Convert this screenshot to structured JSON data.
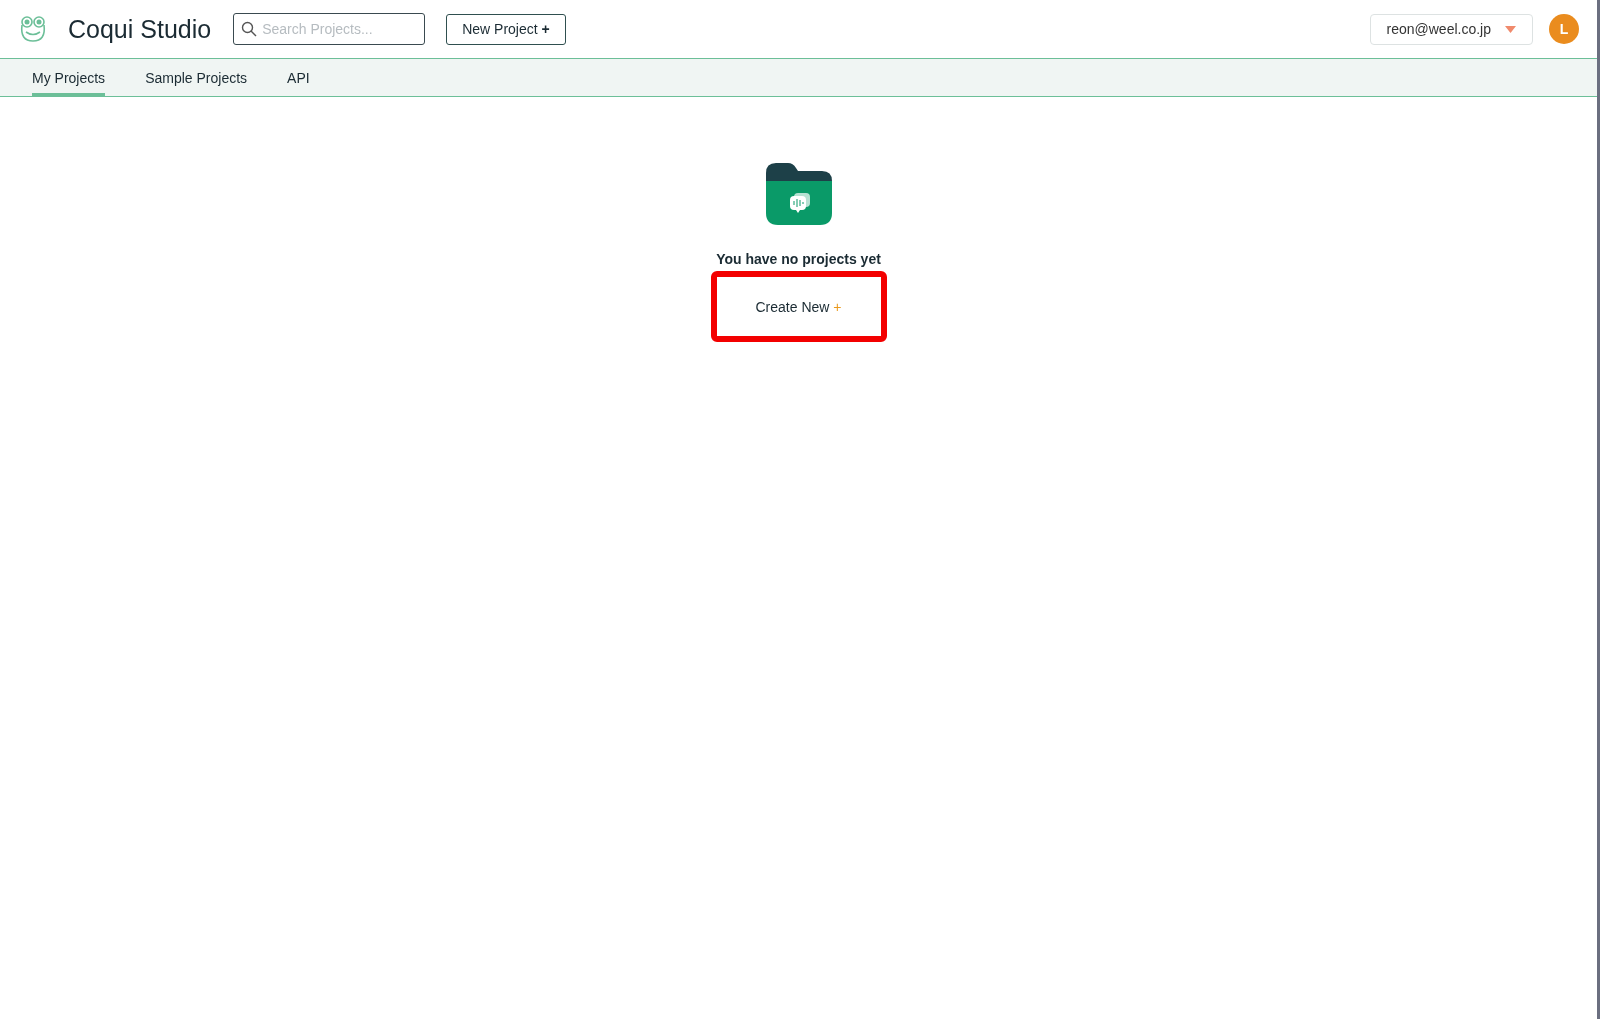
{
  "header": {
    "title": "Coqui Studio",
    "search": {
      "placeholder": "Search Projects..."
    },
    "new_project_button": {
      "label": "New Project",
      "plus": "+"
    },
    "account": {
      "email": "reon@weel.co.jp"
    },
    "avatar": {
      "initial": "L"
    }
  },
  "tabs": [
    {
      "label": "My Projects",
      "selected": true
    },
    {
      "label": "Sample Projects",
      "selected": false
    },
    {
      "label": "API",
      "selected": false
    }
  ],
  "empty_state": {
    "message": "You have no projects yet",
    "create_button": {
      "label": "Create New",
      "plus": "+",
      "highlighted": true
    }
  }
}
